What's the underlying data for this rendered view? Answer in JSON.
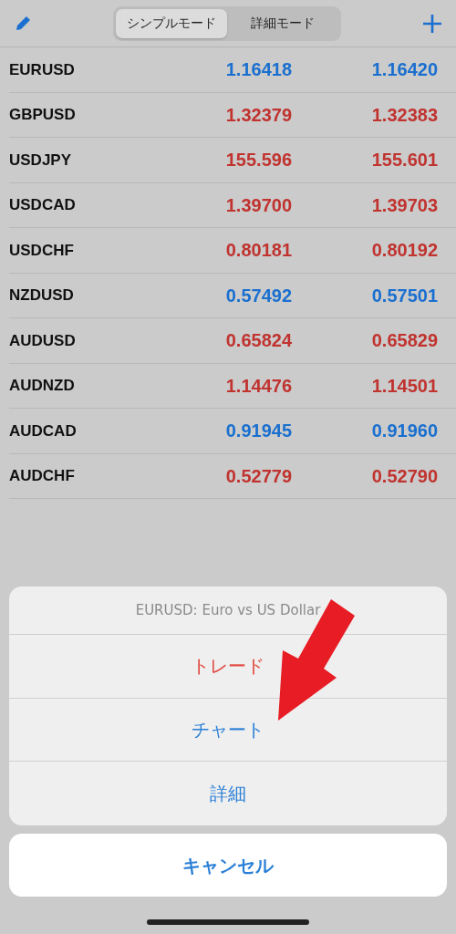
{
  "toolbar": {
    "segments": [
      {
        "label": "シンプルモード",
        "selected": true
      },
      {
        "label": "詳細モード",
        "selected": false
      }
    ]
  },
  "quotes": [
    {
      "symbol": "EURUSD",
      "bid": "1.16418",
      "ask": "1.16420",
      "color": "#1a6fcf"
    },
    {
      "symbol": "GBPUSD",
      "bid": "1.32379",
      "ask": "1.32383",
      "color": "#c0332f"
    },
    {
      "symbol": "USDJPY",
      "bid": "155.596",
      "ask": "155.601",
      "color": "#c0332f"
    },
    {
      "symbol": "USDCAD",
      "bid": "1.39700",
      "ask": "1.39703",
      "color": "#c0332f"
    },
    {
      "symbol": "USDCHF",
      "bid": "0.80181",
      "ask": "0.80192",
      "color": "#c0332f"
    },
    {
      "symbol": "NZDUSD",
      "bid": "0.57492",
      "ask": "0.57501",
      "color": "#1a6fcf"
    },
    {
      "symbol": "AUDUSD",
      "bid": "0.65824",
      "ask": "0.65829",
      "color": "#c0332f"
    },
    {
      "symbol": "AUDNZD",
      "bid": "1.14476",
      "ask": "1.14501",
      "color": "#c0332f"
    },
    {
      "symbol": "AUDCAD",
      "bid": "0.91945",
      "ask": "0.91960",
      "color": "#1a6fcf"
    },
    {
      "symbol": "AUDCHF",
      "bid": "0.52779",
      "ask": "0.52790",
      "color": "#c0332f"
    }
  ],
  "action_sheet": {
    "title": "EURUSD: Euro vs US Dollar",
    "actions": [
      {
        "label": "トレード",
        "color": "#e0463c"
      },
      {
        "label": "チャート",
        "color": "#2a7fd6"
      },
      {
        "label": "詳細",
        "color": "#2a7fd6"
      }
    ],
    "cancel": "キャンセル"
  }
}
